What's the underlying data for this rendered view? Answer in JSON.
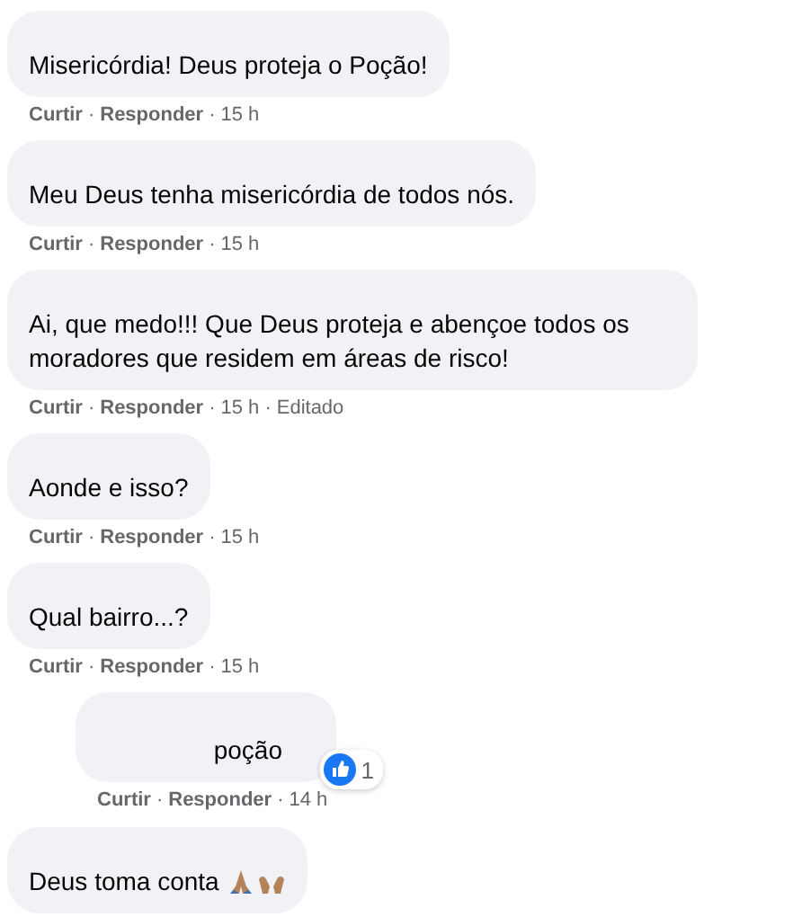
{
  "comments": [
    {
      "kind": "comment",
      "text": "Misericórdia! Deus proteja o Poção!",
      "actions": [
        "Curtir",
        "Responder"
      ],
      "separator": "·",
      "time": "15 h"
    },
    {
      "kind": "comment",
      "text": "Meu Deus tenha misericórdia de todos nós.",
      "actions": [
        "Curtir",
        "Responder"
      ],
      "separator": "·",
      "time": "15 h"
    },
    {
      "kind": "comment",
      "text": "Ai, que medo!!! Que Deus proteja e abençoe todos os moradores que residem em áreas de risco!",
      "actions": [
        "Curtir",
        "Responder"
      ],
      "separator": "·",
      "time": "15 h",
      "edited": "Editado"
    },
    {
      "kind": "comment",
      "text": "Aonde e isso?",
      "actions": [
        "Curtir",
        "Responder"
      ],
      "separator": "·",
      "time": "15 h"
    },
    {
      "kind": "comment",
      "text": "Qual bairro...?",
      "actions": [
        "Curtir",
        "Responder"
      ],
      "separator": "·",
      "time": "15 h"
    },
    {
      "kind": "reply",
      "text": "poção",
      "like_count": "1",
      "actions": [
        "Curtir",
        "Responder"
      ],
      "separator": "·",
      "time": "14 h"
    },
    {
      "kind": "comment",
      "text": "Deus toma conta",
      "emoji_trail": true
    }
  ]
}
